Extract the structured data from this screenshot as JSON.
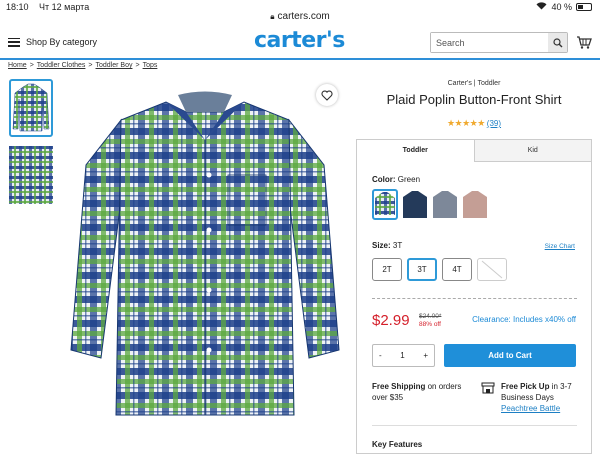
{
  "status_bar": {
    "time": "18:10",
    "date": "Чт 12 марта",
    "url": "carters.com",
    "battery": "40 %"
  },
  "header": {
    "menu_label": "Shop By category",
    "logo": "carter's",
    "search_placeholder": "Search"
  },
  "breadcrumb": [
    "Home",
    "Toddler Clothes",
    "Toddler Boy",
    "Tops"
  ],
  "product": {
    "brand": "Carter's | Toddler",
    "title": "Plaid Poplin Button-Front Shirt",
    "stars": "★★★★★",
    "review_count": "(39)",
    "rating": 5
  },
  "tabs": [
    "Toddler",
    "Kid"
  ],
  "color": {
    "label": "Color:",
    "value": "Green"
  },
  "swatch_colors": [
    "#3b6b3e",
    "#243a5a",
    "#7d8899",
    "#c49e95"
  ],
  "size": {
    "label": "Size:",
    "value": "3T",
    "chart_link": "Size Chart",
    "options": [
      "2T",
      "3T",
      "4T",
      ""
    ]
  },
  "pricing": {
    "price": "$2.99",
    "original": "$24.00*",
    "off": "88% off",
    "clearance": "Clearance: Includes x40% off"
  },
  "quantity": {
    "minus": "-",
    "value": "1",
    "plus": "+"
  },
  "add_to_cart": "Add to Cart",
  "shipping": {
    "bold": "Free Shipping",
    "text": " on orders over $35"
  },
  "pickup": {
    "bold": "Free Pick Up",
    "text": " in 3-7 Business Days",
    "store": "Peachtree Battle"
  },
  "key_features": "Key Features",
  "colors": {
    "accent": "#1f8fd9",
    "sale": "#d41f2a",
    "star": "#f0a92e"
  }
}
